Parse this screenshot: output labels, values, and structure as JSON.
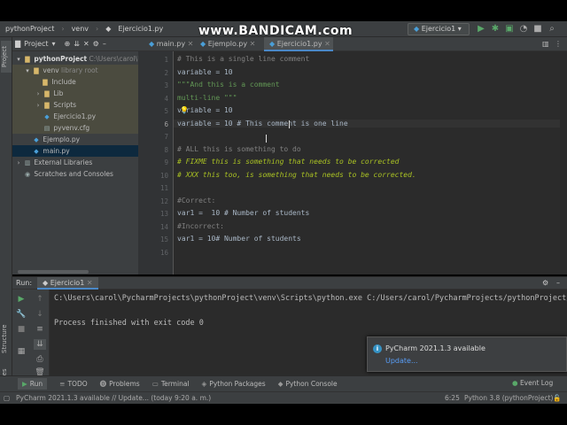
{
  "watermark": "www.BANDICAM.com",
  "navbar": {
    "crumbs": [
      "pythonProject",
      "venv",
      "Ejercicio1.py"
    ],
    "run_config": "Ejercicio1"
  },
  "left_strip": {
    "project": "Project",
    "structure": "Structure",
    "favorites": "Favorites"
  },
  "project_panel": {
    "title": "Project",
    "tree": [
      {
        "label": "pythonProject",
        "hint": "C:\\Users\\carol\\P",
        "icon": "folder-icon",
        "arrow": "▾"
      },
      {
        "label": "venv",
        "hint": "library root",
        "icon": "folder-icon",
        "arrow": "▾"
      },
      {
        "label": "Include",
        "hint": "",
        "icon": "folder-icon",
        "arrow": ""
      },
      {
        "label": "Lib",
        "hint": "",
        "icon": "folder-icon",
        "arrow": "›"
      },
      {
        "label": "Scripts",
        "hint": "",
        "icon": "folder-icon",
        "arrow": "›"
      },
      {
        "label": "Ejercicio1.py",
        "hint": "",
        "icon": "python-file-icon",
        "arrow": ""
      },
      {
        "label": "pyvenv.cfg",
        "hint": "",
        "icon": "cfg-file-icon",
        "arrow": ""
      },
      {
        "label": "Ejemplo.py",
        "hint": "",
        "icon": "python-file-icon",
        "arrow": ""
      },
      {
        "label": "main.py",
        "hint": "",
        "icon": "python-file-icon",
        "arrow": ""
      },
      {
        "label": "External Libraries",
        "hint": "",
        "icon": "library-icon",
        "arrow": "›"
      },
      {
        "label": "Scratches and Consoles",
        "hint": "",
        "icon": "scratch-icon",
        "arrow": ""
      }
    ]
  },
  "editor": {
    "tabs": [
      "main.py",
      "Ejemplo.py",
      "Ejercicio1.py"
    ],
    "active_tab": "Ejercicio1.py",
    "line_numbers": [
      "1",
      "2",
      "3",
      "4",
      "5",
      "6",
      "7",
      "8",
      "9",
      "10",
      "11",
      "12",
      "13",
      "14",
      "15",
      "16"
    ],
    "lines": [
      "# This is a single line comment",
      "variable = 10",
      "\"\"\"And this is a comment",
      "multi-line \"\"\"",
      "variable = 10",
      "variable = 10 # This comment is one line",
      "",
      "# ALL this is something to do",
      "# FIXME this is something that needs to be corrected",
      "# XXX this too, is something that needs to be corrected.",
      "",
      "#Correct:",
      "var1 =  10 # Number of students",
      "#Incorrect:",
      "var1 = 10# Number of students",
      ""
    ]
  },
  "run_panel": {
    "label": "Run:",
    "tab": "Ejercicio1",
    "console": [
      "C:\\Users\\carol\\PycharmProjects\\pythonProject\\venv\\Scripts\\python.exe C:/Users/carol/PycharmProjects/pythonProject/venv/Ejercicio1.py",
      "",
      "Process finished with exit code 0"
    ]
  },
  "notification": {
    "title": "PyCharm 2021.1.3 available",
    "link": "Update..."
  },
  "bottom_tools": [
    "Run",
    "TODO",
    "Problems",
    "Terminal",
    "Python Packages",
    "Python Console"
  ],
  "event_log": "Event Log",
  "status": {
    "message": "PyCharm 2021.1.3 available // Update... (today 9:20 a. m.)",
    "position": "6:25",
    "interpreter": "Python 3.8 (pythonProject)"
  }
}
